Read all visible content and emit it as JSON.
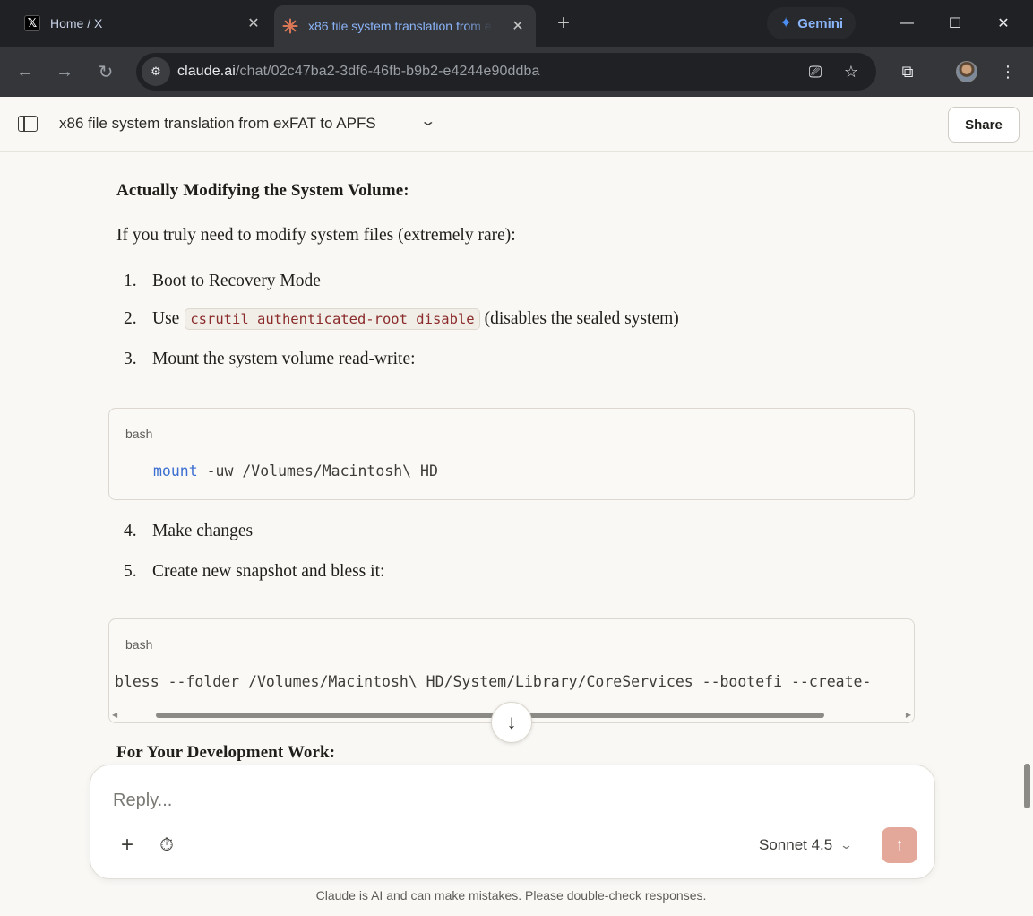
{
  "browser": {
    "tabs": [
      {
        "title": "Home / X",
        "active": false
      },
      {
        "title": "x86 file system translation from exFAT to APFS",
        "active": true
      }
    ],
    "gemini_label": "Gemini",
    "url_host": "claude.ai",
    "url_path": "/chat/02c47ba2-3df6-46fb-b9b2-e4244e90ddba"
  },
  "header": {
    "chat_title": "x86 file system translation from exFAT to APFS",
    "share_label": "Share"
  },
  "message": {
    "heading1": "Actually Modifying the System Volume:",
    "intro": "If you truly need to modify system files (extremely rare):",
    "steps": [
      {
        "num": "1.",
        "text": "Boot to Recovery Mode"
      },
      {
        "num": "2.",
        "pre": "Use",
        "code": "csrutil authenticated-root disable",
        "post": "(disables the sealed system)"
      },
      {
        "num": "3.",
        "text": "Mount the system volume read-write:"
      },
      {
        "num": "4.",
        "text": "Make changes"
      },
      {
        "num": "5.",
        "text": "Create new snapshot and bless it:"
      }
    ],
    "code1": {
      "lang": "bash",
      "cmd": "mount",
      "args": " -uw /Volumes/Macintosh\\ HD"
    },
    "code2": {
      "lang": "bash",
      "line": "bless --folder /Volumes/Macintosh\\ HD/System/Library/CoreServices --bootefi --create-"
    },
    "heading2": "For Your Development Work:"
  },
  "composer": {
    "placeholder": "Reply...",
    "model": "Sonnet 4.5"
  },
  "footer": {
    "disclaimer": "Claude is AI and can make mistakes. Please double-check responses."
  }
}
